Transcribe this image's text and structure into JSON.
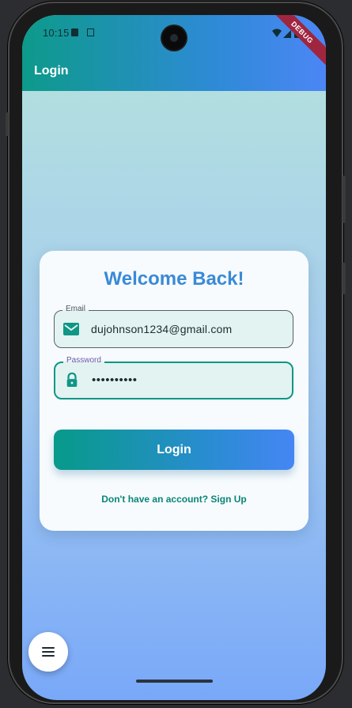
{
  "status_bar": {
    "time": "10:15",
    "icons": [
      "sd-card-icon",
      "a-box-icon",
      "wifi-icon",
      "signal-icon",
      "battery-icon"
    ]
  },
  "debug_banner": {
    "label": "DEBUG"
  },
  "app_bar": {
    "title": "Login"
  },
  "login_card": {
    "title": "Welcome Back!",
    "email_field": {
      "label": "Email",
      "value": "dujohnson1234@gmail.com",
      "icon": "mail-icon"
    },
    "password_field": {
      "label": "Password",
      "value": "••••••••••",
      "icon": "lock-icon"
    },
    "login_button": "Login",
    "signup_link": "Don't have an account? Sign Up"
  },
  "fab": {
    "icon": "menu-icon"
  },
  "colors": {
    "appbar_start": "#0d9a8a",
    "appbar_end": "#4c86f5",
    "title_blue": "#3a8ad6",
    "accent_teal": "#0f9686",
    "debug_red": "#a0263f"
  }
}
